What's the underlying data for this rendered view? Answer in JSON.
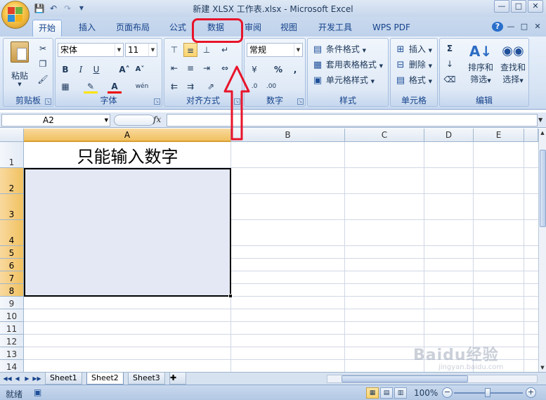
{
  "window": {
    "title": "新建 XLSX 工作表.xlsx - Microsoft Excel"
  },
  "tabs": [
    "开始",
    "插入",
    "页面布局",
    "公式",
    "数据",
    "审阅",
    "视图",
    "开发工具",
    "WPS PDF"
  ],
  "active_tab": "开始",
  "highlighted_tab": "数据",
  "ribbon": {
    "clipboard": {
      "label": "剪贴板",
      "paste": "粘贴"
    },
    "font": {
      "label": "字体",
      "font_name": "宋体",
      "font_size": "11"
    },
    "alignment": {
      "label": "对齐方式"
    },
    "number": {
      "label": "数字",
      "format": "常规"
    },
    "styles": {
      "label": "样式",
      "conditional": "条件格式",
      "table_format": "套用表格格式",
      "cell_styles": "单元格样式"
    },
    "cells": {
      "label": "单元格",
      "insert": "插入",
      "delete": "删除",
      "format": "格式"
    },
    "editing": {
      "label": "编辑",
      "sort": "排序和",
      "filter": "筛选",
      "find": "查找和",
      "select": "选择"
    }
  },
  "formula_bar": {
    "name_box": "A2",
    "fx": "fx",
    "formula": ""
  },
  "grid": {
    "columns": [
      "A",
      "B",
      "C",
      "D",
      "E"
    ],
    "selected_column": "A",
    "rows": [
      "1",
      "2",
      "3",
      "4",
      "5",
      "6",
      "7",
      "8",
      "9",
      "10",
      "11",
      "12",
      "13",
      "14"
    ],
    "selected_rows": [
      "2",
      "3",
      "4",
      "5",
      "6",
      "7",
      "8"
    ],
    "cell_A1": "只能输入数字"
  },
  "sheets": [
    "Sheet1",
    "Sheet2",
    "Sheet3"
  ],
  "active_sheet": "Sheet2",
  "status": {
    "ready": "就绪",
    "zoom": "100%"
  },
  "watermark": {
    "brand": "Baidu经验",
    "url": "jingyan.baidu.com"
  },
  "colors": {
    "highlight_red": "#e8142a",
    "selection_fill": "#e3e8f4",
    "header_selected": "#f1c15f"
  }
}
